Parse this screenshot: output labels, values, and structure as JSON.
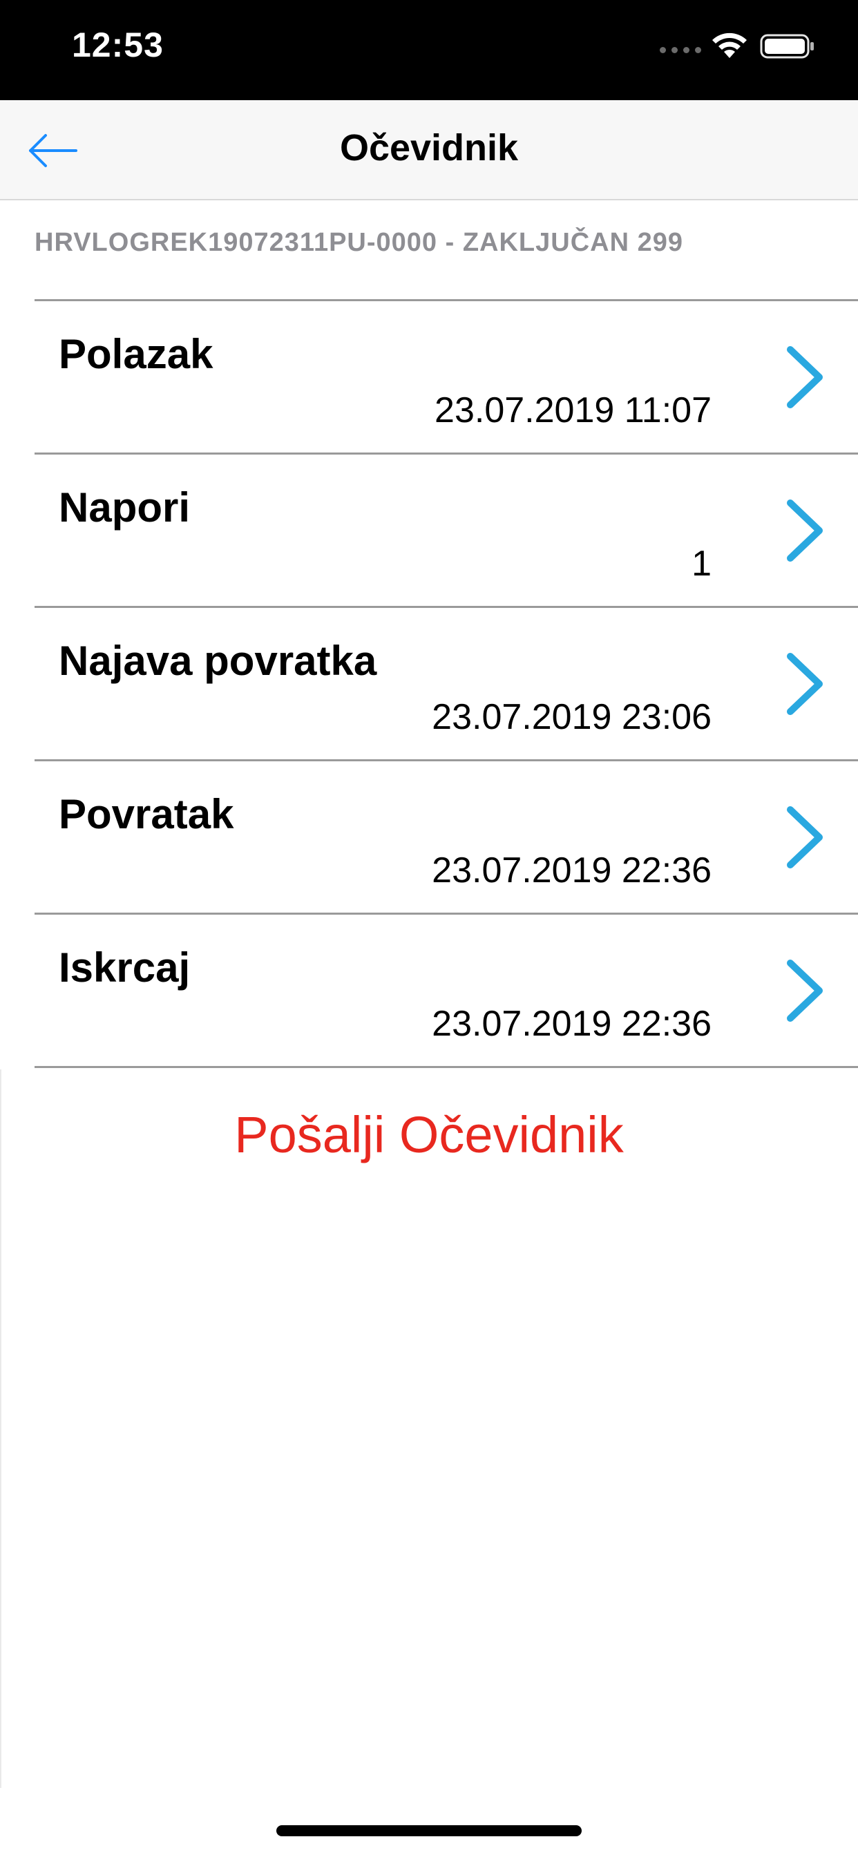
{
  "status_bar": {
    "time": "12:53",
    "signal_icon": "signal-dots-icon",
    "wifi_icon": "wifi-icon",
    "battery_icon": "battery-icon"
  },
  "nav": {
    "title": "Očevidnik",
    "back_icon": "arrow-left-icon"
  },
  "section_header": "HRVLOGREK19072311PU-0000 - ZAKLJUČAN 299",
  "items": [
    {
      "title": "Polazak",
      "value": "23.07.2019 11:07"
    },
    {
      "title": "Napori",
      "value": "1"
    },
    {
      "title": "Najava povratka",
      "value": "23.07.2019 23:06"
    },
    {
      "title": "Povratak",
      "value": "23.07.2019 22:36"
    },
    {
      "title": "Iskrcaj",
      "value": "23.07.2019 22:36"
    }
  ],
  "send_button": "Pošalji Očevidnik",
  "colors": {
    "accent_blue": "#1a8cff",
    "chevron_blue": "#2aa8e0",
    "destructive_red": "#e8281f"
  }
}
